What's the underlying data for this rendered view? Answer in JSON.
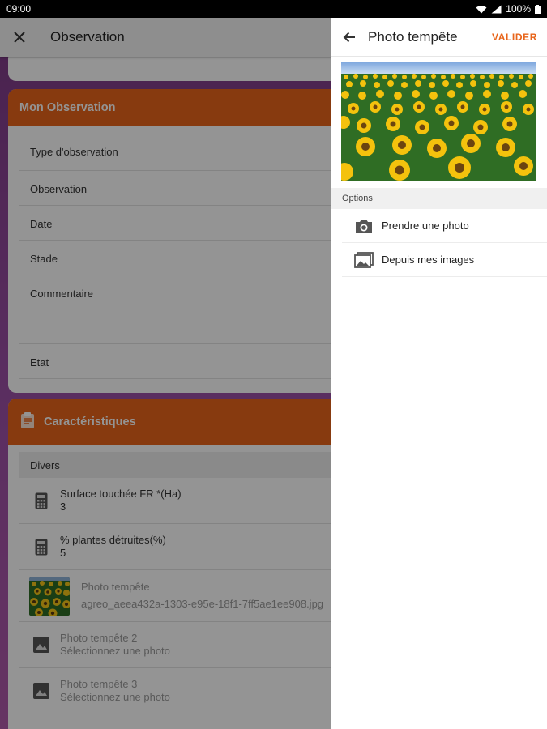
{
  "status_bar": {
    "time": "09:00",
    "battery": "100%"
  },
  "app": {
    "title": "Observation",
    "observation_card": {
      "header": "Mon Observation",
      "fields": [
        "Type d'observation",
        "Observation",
        "Date",
        "Stade",
        "Commentaire",
        "Etat"
      ]
    },
    "characteristics_card": {
      "header": "Caractéristiques",
      "group": "Divers",
      "items": [
        {
          "label": "Surface touchée FR *(Ha)",
          "value": "3"
        },
        {
          "label": "% plantes détruites(%)",
          "value": "5"
        },
        {
          "label": "Photo tempête",
          "value": "agreo_aeea432a-1303-e95e-18f1-7ff5ae1ee908.jpg"
        },
        {
          "label": "Photo tempête 2",
          "value": "Sélectionnez une photo"
        },
        {
          "label": "Photo tempête 3",
          "value": "Sélectionnez une photo"
        }
      ]
    }
  },
  "panel": {
    "title": "Photo tempête",
    "confirm_label": "VALIDER",
    "options_label": "Options",
    "options": [
      {
        "label": "Prendre une photo",
        "icon": "camera-icon"
      },
      {
        "label": "Depuis mes images",
        "icon": "gallery-icon"
      }
    ]
  },
  "colors": {
    "accent": "#e8651b",
    "background": "#9b4fa6"
  }
}
